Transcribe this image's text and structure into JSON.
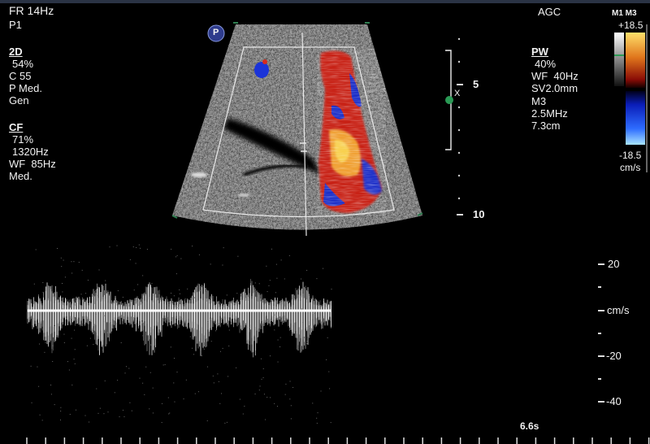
{
  "header": {
    "frame_rate": "FR 14Hz",
    "preset": "P1",
    "agc": "AGC"
  },
  "mode_2d": {
    "title": "2D",
    "gain": "54%",
    "compression": "C 55",
    "power": "P Med.",
    "freq": "Gen"
  },
  "mode_cf": {
    "title": "CF",
    "gain": "71%",
    "prf": "1320Hz",
    "wall_filter": "WF  85Hz",
    "filter": "Med."
  },
  "mode_pw": {
    "title": "PW",
    "gain": "40%",
    "wall_filter": "WF  40Hz",
    "sample_volume": "SV2.0mm",
    "mode": "M3",
    "freq": "2.5MHz",
    "depth": "7.3cm"
  },
  "color_bar": {
    "label": "M1 M3",
    "max": "+18.5",
    "min": "-18.5",
    "unit": "cm/s"
  },
  "depth_scale": {
    "mark_5": "5",
    "mark_10": "10"
  },
  "gate_marker": "X",
  "probe_badge": "P",
  "spectral_scale": {
    "p20": "20",
    "unit": "cm/s",
    "m20": "-20",
    "m40": "-40"
  },
  "sweep_time": "6.6s",
  "colors": {
    "background": "#000000",
    "color_red": "#d8281c",
    "color_yellow": "#f4b33a",
    "color_blue": "#1a3bd6",
    "gate_dot": "#2a9a55"
  }
}
